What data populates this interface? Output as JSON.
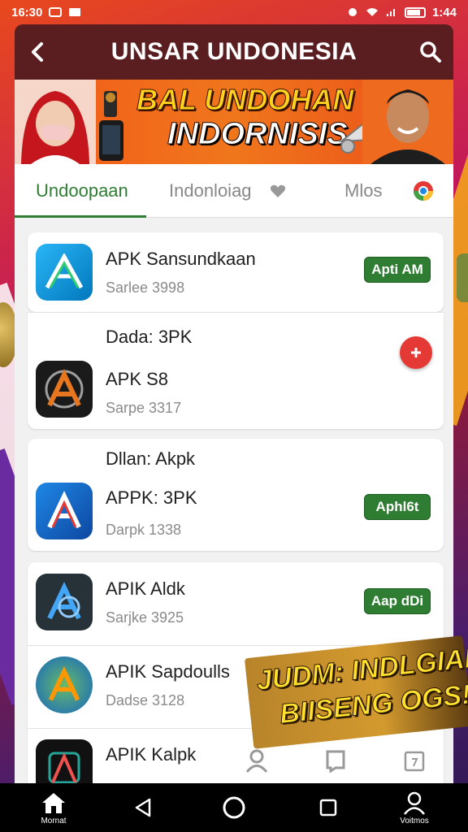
{
  "status_bar": {
    "time_left": "16:30",
    "time_right": "1:44"
  },
  "header": {
    "title": "UNSAR UNDONESIA"
  },
  "banner": {
    "line1": "BAL UNDOHAN",
    "line2": "INDORNISIS"
  },
  "tabs": [
    {
      "label": "Undoopaan",
      "active": true
    },
    {
      "label": "Indonloiag",
      "active": false
    },
    {
      "label": "Mlos",
      "active": false
    }
  ],
  "cards": [
    {
      "rows": [
        {
          "name": "APK Sansundkaan",
          "meta": "Sarlee 3998",
          "button": "Apti AM"
        }
      ]
    },
    {
      "section_label": "Dada: 3PK",
      "rows": [
        {
          "name": "APK S8",
          "meta": "Sarpe 3317"
        }
      ]
    },
    {
      "section_label": "Dllan: Akpk",
      "rows": [
        {
          "name": "APPK: 3PK",
          "meta": "Darpk 1338",
          "button": "Aphl6t"
        }
      ]
    },
    {
      "rows": [
        {
          "name": "APIK Aldk",
          "meta": "Sarjke 3925",
          "button": "Aap dDi"
        },
        {
          "name": "APIK Sapdoulls",
          "meta": "Dadse 3128"
        },
        {
          "name": "APIK Kalpk",
          "meta": ""
        }
      ]
    }
  ],
  "promo": {
    "line1": "JUDM: INDLGIAB",
    "line2": "BIISENG OGS!!"
  },
  "nav": {
    "home_label": "Mornat",
    "profile_label": "Voitmos"
  },
  "colors": {
    "header": "#5a1e20",
    "accent_green": "#2e7d32",
    "banner_orange": "#f0761c",
    "fab_red": "#e53935"
  },
  "icons": [
    "back-arrow-icon",
    "search-icon",
    "heart-icon",
    "chrome-icon",
    "plus-icon",
    "person-icon",
    "book-icon",
    "calendar-icon",
    "home-icon",
    "back-triangle-icon",
    "circle-home-icon",
    "square-recents-icon"
  ]
}
